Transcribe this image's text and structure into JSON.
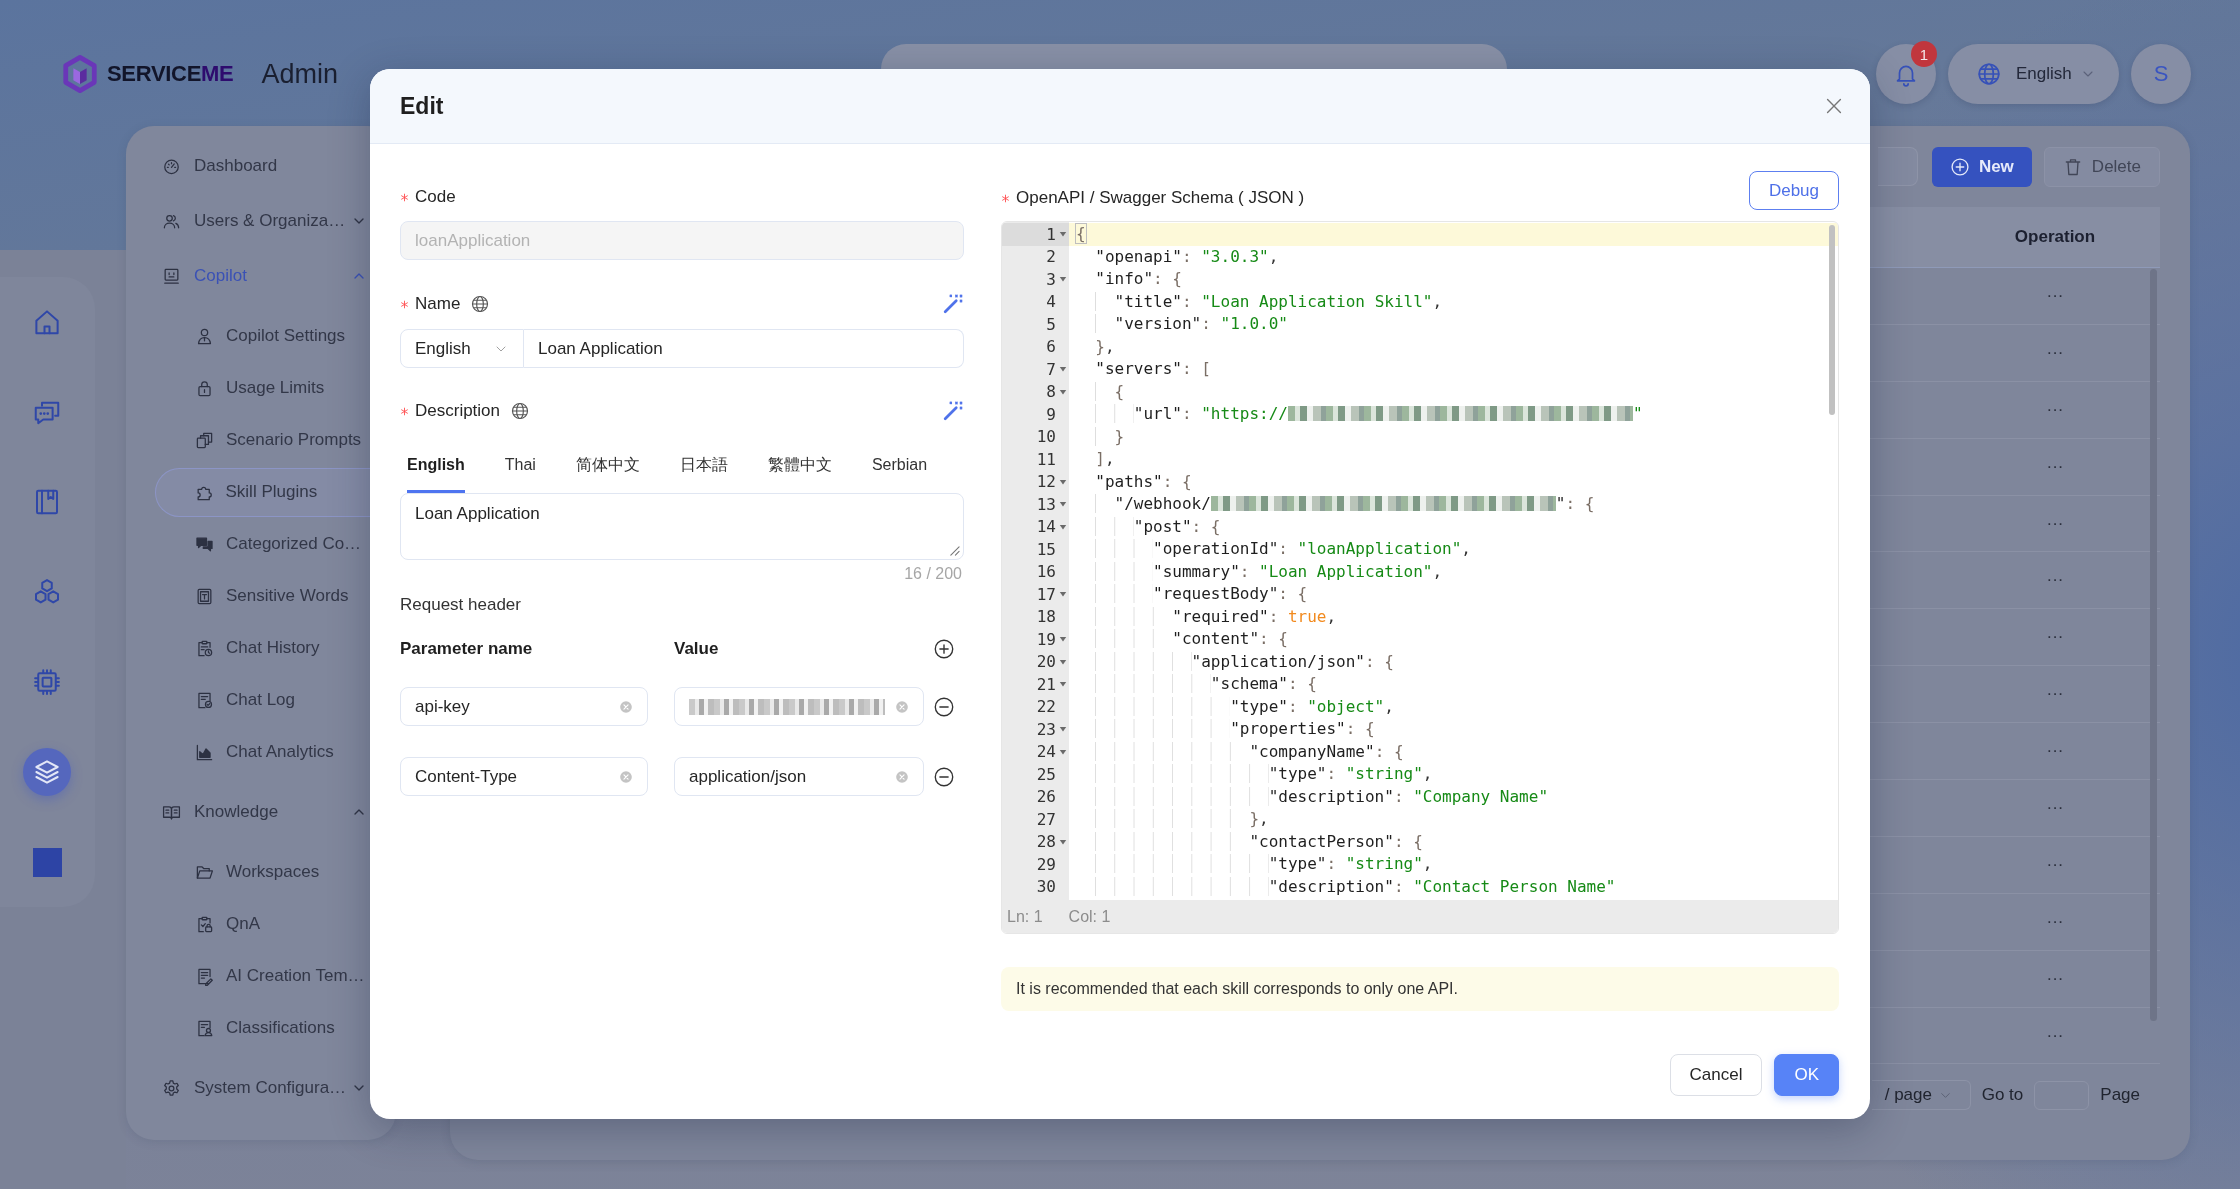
{
  "header": {
    "brand": {
      "name": "SERVICE",
      "accent": "ME"
    },
    "app_name": "Admin",
    "notifications": "1",
    "language": "English",
    "avatar": "S"
  },
  "rail": {
    "items": [
      {
        "selected": false
      },
      {
        "selected": false
      },
      {
        "selected": false
      },
      {
        "selected": false
      },
      {
        "selected": false
      },
      {
        "selected": true
      },
      {
        "selected": false
      }
    ]
  },
  "sidebar": {
    "items": [
      {
        "kind": "link",
        "label": "Dashboard",
        "selected": false
      },
      {
        "kind": "group",
        "label": "Users & Organiza…",
        "expanded": false
      },
      {
        "kind": "group",
        "label": "Copilot",
        "expanded": true,
        "children": [
          {
            "label": "Copilot Settings",
            "selected": false
          },
          {
            "label": "Usage Limits",
            "selected": false
          },
          {
            "label": "Scenario Prompts",
            "selected": false
          },
          {
            "label": "Skill Plugins",
            "selected": true
          },
          {
            "label": "Categorized Co…",
            "selected": false
          },
          {
            "label": "Sensitive Words",
            "selected": false
          },
          {
            "label": "Chat History",
            "selected": false
          },
          {
            "label": "Chat Log",
            "selected": false
          },
          {
            "label": "Chat Analytics",
            "selected": false
          }
        ]
      },
      {
        "kind": "group",
        "label": "Knowledge",
        "expanded": true,
        "children": [
          {
            "label": "Workspaces",
            "selected": false
          },
          {
            "label": "QnA",
            "selected": false
          },
          {
            "label": "AI Creation Tem…",
            "selected": false
          },
          {
            "label": "Classifications",
            "selected": false
          }
        ]
      },
      {
        "kind": "group",
        "label": "System Configura…",
        "expanded": false
      }
    ]
  },
  "content": {
    "buttons": [
      {
        "label": "New",
        "kind": "primary",
        "disabled": false
      },
      {
        "label": "Delete",
        "kind": "default",
        "disabled": true
      }
    ],
    "table": {
      "columns": [
        "Operation"
      ],
      "rows": [
        {
          "operation": "···"
        },
        {
          "operation": "···"
        },
        {
          "operation": "···"
        },
        {
          "operation": "···"
        },
        {
          "operation": "···"
        },
        {
          "operation": "···"
        },
        {
          "operation": "···"
        },
        {
          "operation": "···"
        },
        {
          "operation": "···"
        },
        {
          "operation": "···"
        },
        {
          "operation": "···"
        },
        {
          "operation": "···"
        },
        {
          "operation": "···"
        },
        {
          "operation": "···"
        }
      ]
    },
    "pagination": {
      "page_size": "/ page",
      "goto": "Go to",
      "page": "Page"
    }
  },
  "modal": {
    "title": "Edit",
    "code": {
      "label": "Code",
      "required": true,
      "value": "loanApplication",
      "disabled": true
    },
    "name": {
      "label": "Name",
      "required": true,
      "language": "English",
      "value": "Loan Application"
    },
    "description": {
      "label": "Description",
      "required": true,
      "tabs": [
        {
          "label": "English",
          "selected": true
        },
        {
          "label": "Thai",
          "selected": false
        },
        {
          "label": "简体中文",
          "selected": false
        },
        {
          "label": "日本語",
          "selected": false
        },
        {
          "label": "繁體中文",
          "selected": false
        },
        {
          "label": "Serbian",
          "selected": false
        }
      ],
      "value": "Loan Application",
      "count": "16 / 200"
    },
    "request_header": {
      "title": "Request header",
      "columns": [
        "Parameter name",
        "Value"
      ],
      "rows": [
        {
          "name": "api-key",
          "value_redacted": true
        },
        {
          "name": "Content-Type",
          "value": "application/json",
          "value_redacted": false
        }
      ]
    },
    "schema": {
      "label": "OpenAPI / Swagger Schema ( JSON )",
      "required": true,
      "debug": "Debug",
      "lines": [
        {
          "number": "1",
          "fold": true,
          "active": true,
          "tokens": [
            {
              "kind": "punct",
              "text": "{"
            }
          ]
        },
        {
          "number": "2",
          "fold": false,
          "active": false,
          "tokens": [
            {
              "kind": "key",
              "text": "  \"openapi\""
            },
            {
              "kind": "punct",
              "text": ": "
            },
            {
              "kind": "string",
              "text": "\"3.0.3\""
            },
            {
              "kind": "plain",
              "text": ","
            }
          ]
        },
        {
          "number": "3",
          "fold": true,
          "active": false,
          "tokens": [
            {
              "kind": "key",
              "text": "  \"info\""
            },
            {
              "kind": "punct",
              "text": ": {"
            }
          ]
        },
        {
          "number": "4",
          "fold": false,
          "active": false,
          "tokens": [
            {
              "kind": "key",
              "text": "    \"title\""
            },
            {
              "kind": "punct",
              "text": ": "
            },
            {
              "kind": "string",
              "text": "\"Loan Application Skill\""
            },
            {
              "kind": "plain",
              "text": ","
            }
          ]
        },
        {
          "number": "5",
          "fold": false,
          "active": false,
          "tokens": [
            {
              "kind": "key",
              "text": "    \"version\""
            },
            {
              "kind": "punct",
              "text": ": "
            },
            {
              "kind": "string",
              "text": "\"1.0.0\""
            }
          ]
        },
        {
          "number": "6",
          "fold": false,
          "active": false,
          "tokens": [
            {
              "kind": "punct",
              "text": "  }"
            },
            {
              "kind": "plain",
              "text": ","
            }
          ]
        },
        {
          "number": "7",
          "fold": true,
          "active": false,
          "tokens": [
            {
              "kind": "key",
              "text": "  \"servers\""
            },
            {
              "kind": "punct",
              "text": ": ["
            }
          ]
        },
        {
          "number": "8",
          "fold": true,
          "active": false,
          "tokens": [
            {
              "kind": "punct",
              "text": "    {"
            }
          ]
        },
        {
          "number": "9",
          "fold": false,
          "active": false,
          "tokens": [
            {
              "kind": "key",
              "text": "      \"url\""
            },
            {
              "kind": "punct",
              "text": ": "
            },
            {
              "kind": "string",
              "text": "\"https://"
            },
            {
              "kind": "redacted"
            },
            {
              "kind": "string",
              "text": "\""
            }
          ]
        },
        {
          "number": "10",
          "fold": false,
          "active": false,
          "tokens": [
            {
              "kind": "punct",
              "text": "    }"
            }
          ]
        },
        {
          "number": "11",
          "fold": false,
          "active": false,
          "tokens": [
            {
              "kind": "punct",
              "text": "  ]"
            },
            {
              "kind": "plain",
              "text": ","
            }
          ]
        },
        {
          "number": "12",
          "fold": true,
          "active": false,
          "tokens": [
            {
              "kind": "key",
              "text": "  \"paths\""
            },
            {
              "kind": "punct",
              "text": ": {"
            }
          ]
        },
        {
          "number": "13",
          "fold": true,
          "active": false,
          "tokens": [
            {
              "kind": "key",
              "text": "    \"/webhook/"
            },
            {
              "kind": "redacted"
            },
            {
              "kind": "key",
              "text": "\""
            },
            {
              "kind": "punct",
              "text": ": {"
            }
          ]
        },
        {
          "number": "14",
          "fold": true,
          "active": false,
          "tokens": [
            {
              "kind": "key",
              "text": "      \"post\""
            },
            {
              "kind": "punct",
              "text": ": {"
            }
          ]
        },
        {
          "number": "15",
          "fold": false,
          "active": false,
          "tokens": [
            {
              "kind": "key",
              "text": "        \"operationId\""
            },
            {
              "kind": "punct",
              "text": ": "
            },
            {
              "kind": "string",
              "text": "\"loanApplication\""
            },
            {
              "kind": "plain",
              "text": ","
            }
          ]
        },
        {
          "number": "16",
          "fold": false,
          "active": false,
          "tokens": [
            {
              "kind": "key",
              "text": "        \"summary\""
            },
            {
              "kind": "punct",
              "text": ": "
            },
            {
              "kind": "string",
              "text": "\"Loan Application\""
            },
            {
              "kind": "plain",
              "text": ","
            }
          ]
        },
        {
          "number": "17",
          "fold": true,
          "active": false,
          "tokens": [
            {
              "kind": "key",
              "text": "        \"requestBody\""
            },
            {
              "kind": "punct",
              "text": ": {"
            }
          ]
        },
        {
          "number": "18",
          "fold": false,
          "active": false,
          "tokens": [
            {
              "kind": "key",
              "text": "          \"required\""
            },
            {
              "kind": "punct",
              "text": ": "
            },
            {
              "kind": "bool",
              "text": "true"
            },
            {
              "kind": "plain",
              "text": ","
            }
          ]
        },
        {
          "number": "19",
          "fold": true,
          "active": false,
          "tokens": [
            {
              "kind": "key",
              "text": "          \"content\""
            },
            {
              "kind": "punct",
              "text": ": {"
            }
          ]
        },
        {
          "number": "20",
          "fold": true,
          "active": false,
          "tokens": [
            {
              "kind": "key",
              "text": "            \"application/json\""
            },
            {
              "kind": "punct",
              "text": ": {"
            }
          ]
        },
        {
          "number": "21",
          "fold": true,
          "active": false,
          "tokens": [
            {
              "kind": "key",
              "text": "              \"schema\""
            },
            {
              "kind": "punct",
              "text": ": {"
            }
          ]
        },
        {
          "number": "22",
          "fold": false,
          "active": false,
          "tokens": [
            {
              "kind": "key",
              "text": "                \"type\""
            },
            {
              "kind": "punct",
              "text": ": "
            },
            {
              "kind": "string",
              "text": "\"object\""
            },
            {
              "kind": "plain",
              "text": ","
            }
          ]
        },
        {
          "number": "23",
          "fold": true,
          "active": false,
          "tokens": [
            {
              "kind": "key",
              "text": "                \"properties\""
            },
            {
              "kind": "punct",
              "text": ": {"
            }
          ]
        },
        {
          "number": "24",
          "fold": true,
          "active": false,
          "tokens": [
            {
              "kind": "key",
              "text": "                  \"companyName\""
            },
            {
              "kind": "punct",
              "text": ": {"
            }
          ]
        },
        {
          "number": "25",
          "fold": false,
          "active": false,
          "tokens": [
            {
              "kind": "key",
              "text": "                    \"type\""
            },
            {
              "kind": "punct",
              "text": ": "
            },
            {
              "kind": "string",
              "text": "\"string\""
            },
            {
              "kind": "plain",
              "text": ","
            }
          ]
        },
        {
          "number": "26",
          "fold": false,
          "active": false,
          "tokens": [
            {
              "kind": "key",
              "text": "                    \"description\""
            },
            {
              "kind": "punct",
              "text": ": "
            },
            {
              "kind": "string",
              "text": "\"Company Name\""
            }
          ]
        },
        {
          "number": "27",
          "fold": false,
          "active": false,
          "tokens": [
            {
              "kind": "punct",
              "text": "                  }"
            },
            {
              "kind": "plain",
              "text": ","
            }
          ]
        },
        {
          "number": "28",
          "fold": true,
          "active": false,
          "tokens": [
            {
              "kind": "key",
              "text": "                  \"contactPerson\""
            },
            {
              "kind": "punct",
              "text": ": {"
            }
          ]
        },
        {
          "number": "29",
          "fold": false,
          "active": false,
          "tokens": [
            {
              "kind": "key",
              "text": "                    \"type\""
            },
            {
              "kind": "punct",
              "text": ": "
            },
            {
              "kind": "string",
              "text": "\"string\""
            },
            {
              "kind": "plain",
              "text": ","
            }
          ]
        },
        {
          "number": "30",
          "fold": false,
          "active": false,
          "tokens": [
            {
              "kind": "key",
              "text": "                    \"description\""
            },
            {
              "kind": "punct",
              "text": ": "
            },
            {
              "kind": "string",
              "text": "\"Contact Person Name\""
            }
          ]
        }
      ],
      "status": {
        "line": "Ln: 1",
        "column": "Col: 1"
      }
    },
    "notice": "It is recommended that each skill corresponds to only one API.",
    "buttons": [
      {
        "label": "Cancel",
        "kind": "default"
      },
      {
        "label": "OK",
        "kind": "primary"
      }
    ]
  }
}
